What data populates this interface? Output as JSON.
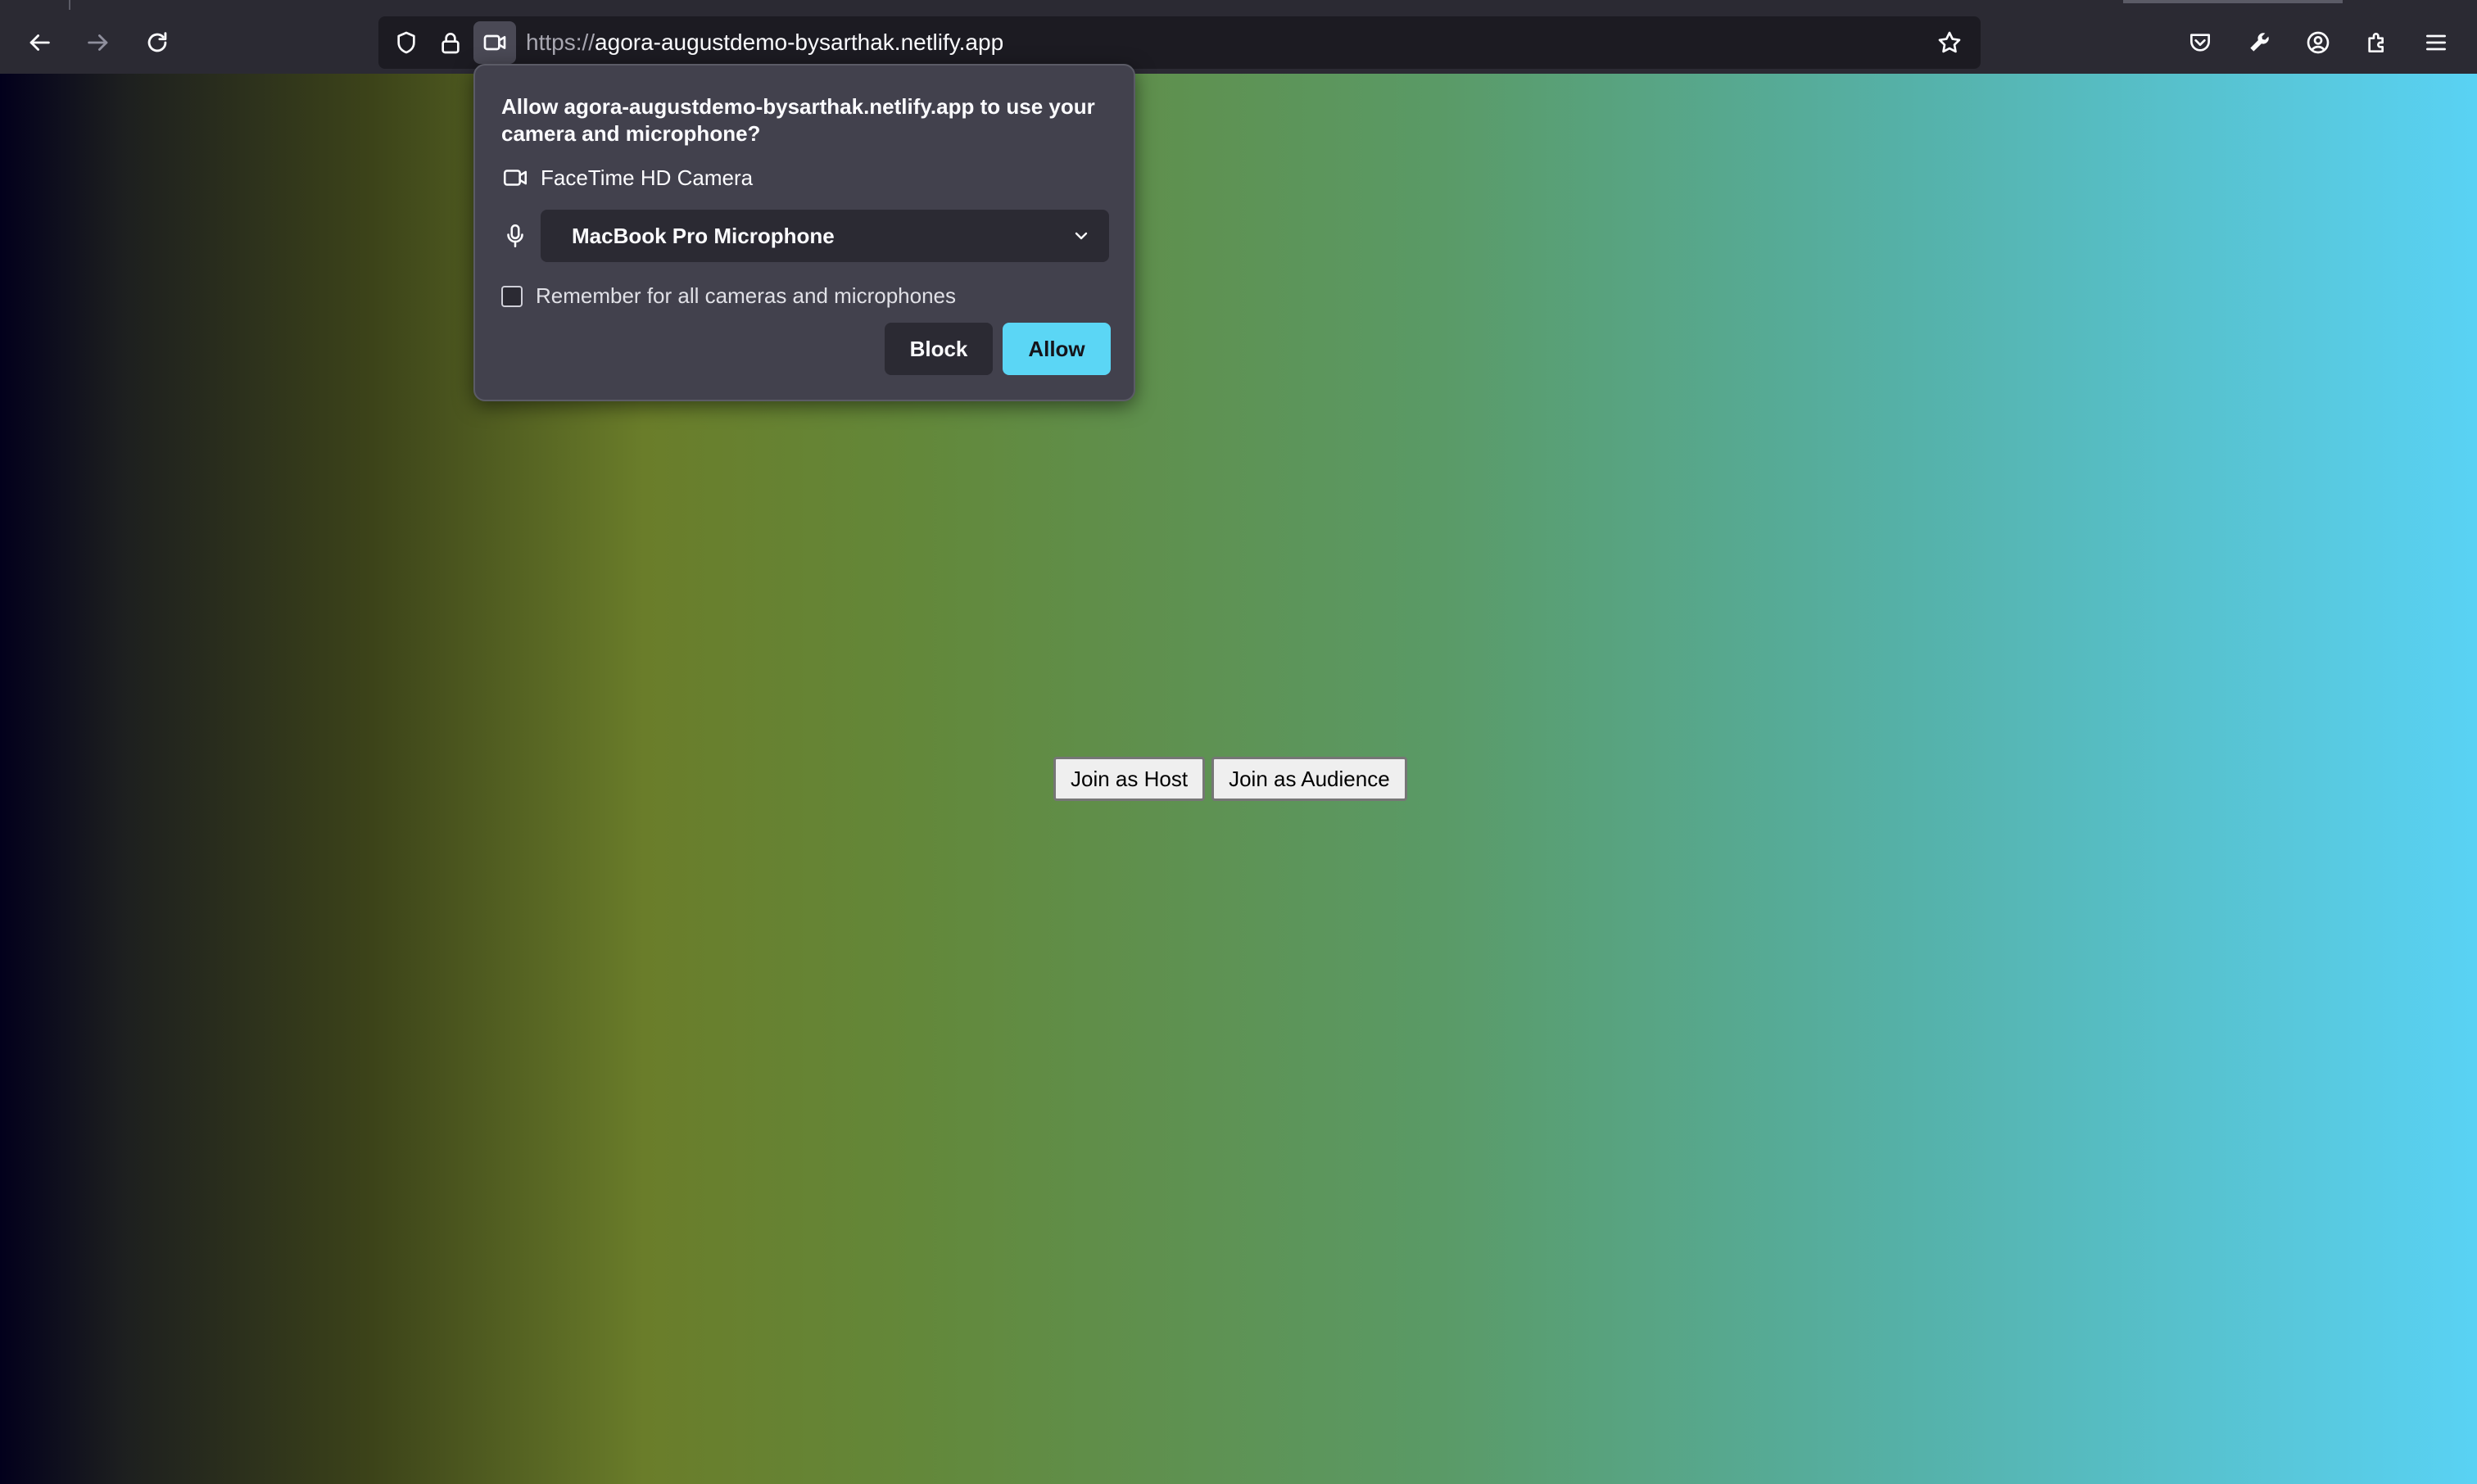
{
  "browser": {
    "url_scheme": "https://",
    "url_host": "agora-augustdemo-bysarthak.netlify.app"
  },
  "permission_popup": {
    "message": "Allow agora-augustdemo-bysarthak.netlify.app to use your camera and microphone?",
    "camera_label": "FaceTime HD Camera",
    "microphone_selected": "MacBook Pro Microphone",
    "remember_label": "Remember for all cameras and microphones",
    "remember_checked": false,
    "block_label": "Block",
    "allow_label": "Allow"
  },
  "page": {
    "join_host_label": "Join as Host",
    "join_audience_label": "Join as Audience"
  },
  "colors": {
    "accent": "#5bd6f5",
    "popup_bg": "#42414d",
    "toolbar_bg": "#2b2a33"
  }
}
